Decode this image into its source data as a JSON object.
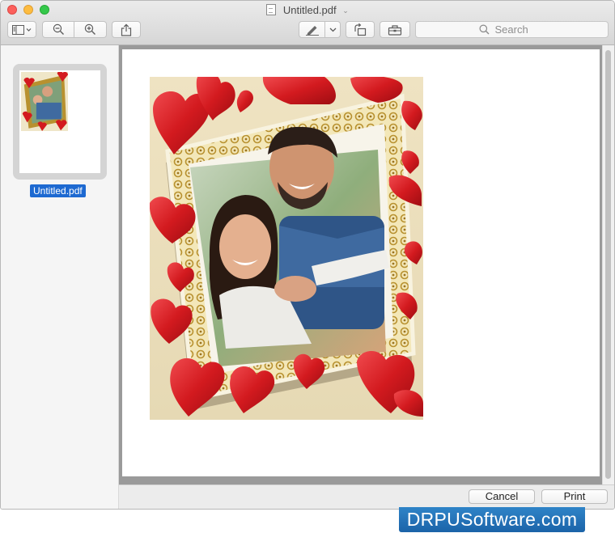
{
  "window": {
    "title": "Untitled.pdf",
    "title_chevron": "⌄"
  },
  "toolbar": {
    "sidebar_toggle": {
      "icon": "sidebar-icon"
    },
    "zoom_out": {
      "icon": "zoom-out-icon"
    },
    "zoom_in": {
      "icon": "zoom-in-icon"
    },
    "share": {
      "icon": "share-icon"
    },
    "markup": {
      "icon": "pen-icon"
    },
    "rotate": {
      "icon": "rotate-icon"
    },
    "toolbox": {
      "icon": "toolbox-icon"
    },
    "search_placeholder": "Search"
  },
  "sidebar": {
    "thumbnail_label": "Untitled.pdf"
  },
  "footer": {
    "cancel_label": "Cancel",
    "print_label": "Print"
  },
  "watermark": {
    "text": "DRPUSoftware.com"
  },
  "colors": {
    "selection": "#1d69d1",
    "heart_red": "#d31a1f",
    "frame_gold": "#b8912f",
    "background_cream": "#efe6c8"
  }
}
